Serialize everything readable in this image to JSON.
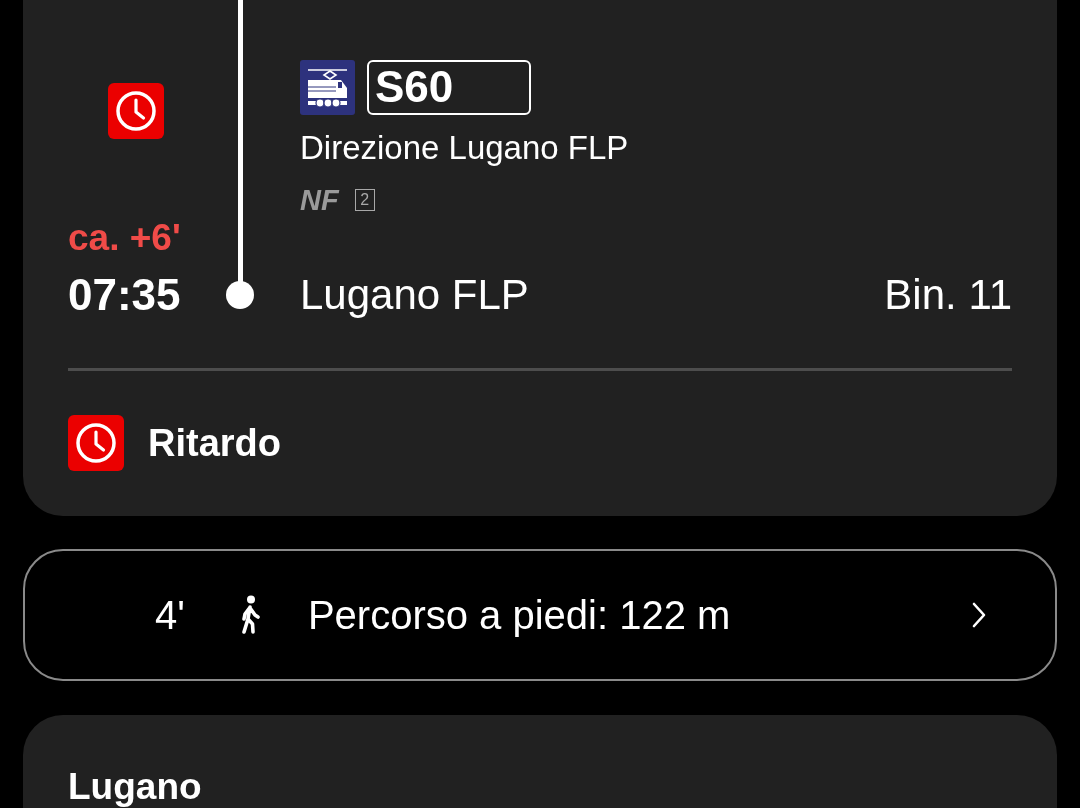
{
  "connection": {
    "service": {
      "line": "S60",
      "direction": "Direzione Lugano FLP",
      "attributes": [
        {
          "kind": "text",
          "text": "NF"
        },
        {
          "kind": "class",
          "text": "2"
        }
      ]
    },
    "arrival": {
      "delay": "ca. +6'",
      "time": "07:35",
      "station": "Lugano FLP",
      "platform": "Bin. 11"
    },
    "notices": [
      {
        "label": "Ritardo"
      }
    ]
  },
  "walk": {
    "duration": "4'",
    "label": "Percorso a piedi: 122 m"
  },
  "next_card": {
    "title": "Lugano"
  }
}
